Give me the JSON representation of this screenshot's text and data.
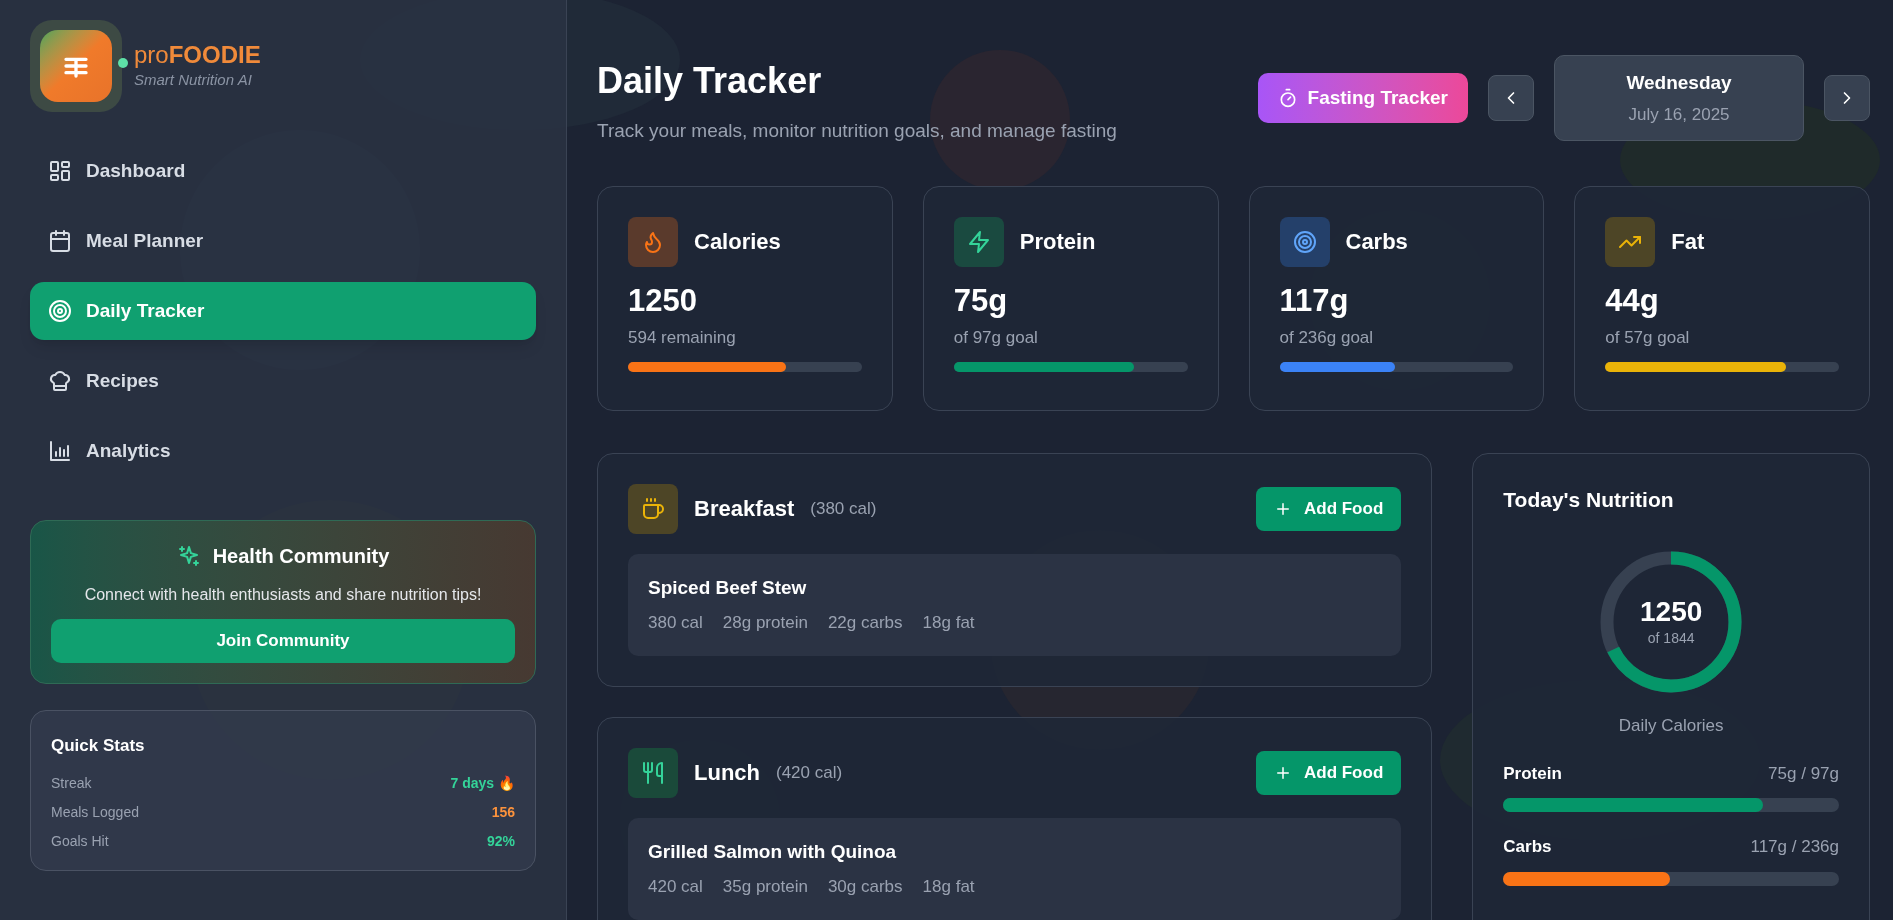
{
  "brand": {
    "name": "pro**FOODIE**",
    "tagline": "Smart Nutrition AI"
  },
  "nav": [
    {
      "label": "Dashboard",
      "kind": "grid",
      "selected": false
    },
    {
      "label": "Meal Planner",
      "kind": "calendar",
      "selected": false
    },
    {
      "label": "Daily Tracker",
      "kind": "target",
      "selected": true
    },
    {
      "label": "Recipes",
      "kind": "chef",
      "selected": false
    },
    {
      "label": "Analytics",
      "kind": "chart",
      "selected": false
    }
  ],
  "community": {
    "title": "Health Community",
    "text": "Connect with health enthusiasts and share nutrition tips!",
    "button": "Join Community"
  },
  "quick_stats": {
    "title": "Quick Stats",
    "items": [
      {
        "label": "Streak",
        "value": "7 days 🔥",
        "color": "#34d399"
      },
      {
        "label": "Meals Logged",
        "value": "156",
        "color": "#fb923c"
      },
      {
        "label": "Goals Hit",
        "value": "92%",
        "color": "#34d399"
      }
    ]
  },
  "header": {
    "title": "Daily Tracker",
    "subtitle": "Track your meals, monitor nutrition goals, and manage fasting",
    "fasting_button": "Fasting Tracker",
    "date": {
      "weekday": "Wednesday",
      "date": "July 16, 2025"
    }
  },
  "stats": [
    {
      "kind": "flame",
      "label": "Calories",
      "value": "1250",
      "note": "594 remaining",
      "level": 0.678,
      "color": "#f97316"
    },
    {
      "kind": "bolt",
      "label": "Protein",
      "value": "75g",
      "note": "of 97g goal",
      "level": 0.773,
      "color": "#059669"
    },
    {
      "kind": "target",
      "label": "Carbs",
      "value": "117g",
      "note": "of 236g goal",
      "level": 0.496,
      "color": "#3b82f6"
    },
    {
      "kind": "trend",
      "label": "Fat",
      "value": "44g",
      "note": "of 57g goal",
      "level": 0.772,
      "color": "#eab308"
    }
  ],
  "meals": [
    {
      "kind": "cup",
      "name": "Breakfast",
      "calories": "(380 cal)",
      "button": "Add Food",
      "foods": [
        {
          "name": "Spiced Beef Stew",
          "facts": [
            "380 cal",
            "28g protein",
            "22g carbs",
            "18g fat"
          ]
        }
      ]
    },
    {
      "kind": "utensils",
      "name": "Lunch",
      "calories": "(420 cal)",
      "button": "Add Food",
      "foods": [
        {
          "name": "Grilled Salmon with Quinoa",
          "facts": [
            "420 cal",
            "35g protein",
            "30g carbs",
            "18g fat"
          ]
        }
      ]
    }
  ],
  "nutrition": {
    "title": "Today's Nutrition",
    "total": "1250",
    "goal": "of 1844",
    "level": 0.678,
    "caption": "Daily Calories",
    "macros": [
      {
        "label": "Protein",
        "amount": "75g / 97g",
        "level": 0.773,
        "color": "#059669"
      },
      {
        "label": "Carbs",
        "amount": "117g / 236g",
        "level": 0.496,
        "color": "#f97316"
      }
    ]
  }
}
